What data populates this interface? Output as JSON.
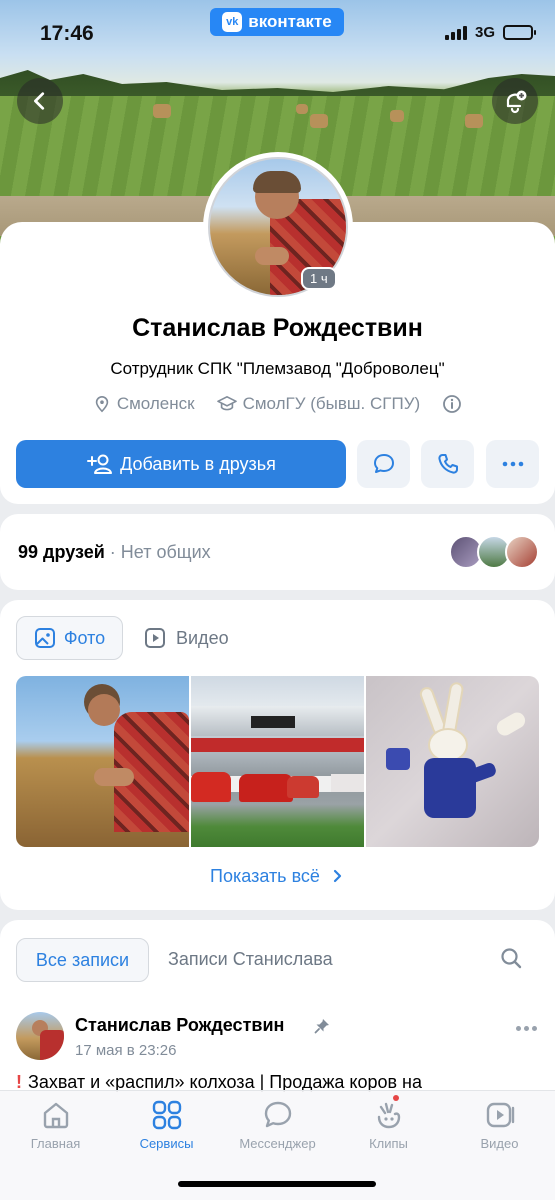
{
  "status_bar": {
    "time": "17:46",
    "app_badge": "вконтакте",
    "app_badge_logo": "vk",
    "network": "3G"
  },
  "profile": {
    "name": "Станислав Рождествин",
    "job": "Сотрудник СПК \"Племзавод \"Доброволец\"",
    "city": "Смоленск",
    "university": "СмолГУ (бывш. СГПУ)",
    "online_badge": "1 ч",
    "add_friend_label": "Добавить в друзья"
  },
  "friends": {
    "count_label": "99 друзей",
    "separator": "·",
    "common_label": "Нет общих",
    "avatar_colors": [
      "#8a7fa0",
      "#6f8f6a",
      "#b4574a"
    ]
  },
  "media": {
    "tabs": [
      {
        "label": "Фото",
        "icon": "photo-icon",
        "active": true
      },
      {
        "label": "Видео",
        "icon": "video-icon",
        "active": false
      }
    ],
    "show_all_label": "Показать всё"
  },
  "posts": {
    "tabs": [
      {
        "label": "Все записи",
        "active": true
      },
      {
        "label": "Записи Станислава",
        "active": false
      }
    ],
    "post": {
      "author": "Станислав Рождествин",
      "date": "17 мая в 23:26",
      "mark": "!",
      "text": "Захват и «распил» колхоза | Продажа коров на"
    }
  },
  "bottom_nav": [
    {
      "label": "Главная",
      "icon": "home-icon",
      "active": false
    },
    {
      "label": "Сервисы",
      "icon": "services-icon",
      "active": true
    },
    {
      "label": "Мессенджер",
      "icon": "messenger-icon",
      "active": false
    },
    {
      "label": "Клипы",
      "icon": "clips-icon",
      "active": false
    },
    {
      "label": "Видео",
      "icon": "video-icon",
      "active": false
    }
  ],
  "colors": {
    "accent": "#2d81e0",
    "muted": "#818c99",
    "badge": "#2787f5"
  }
}
